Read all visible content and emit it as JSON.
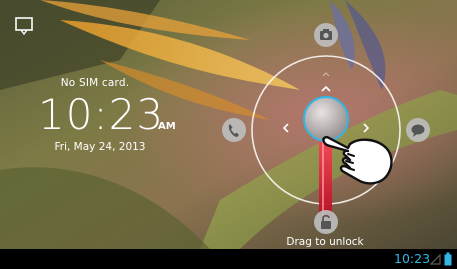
{
  "lockscreen": {
    "sim_status": "No SIM card.",
    "time": "10:23",
    "ampm": "AM",
    "date": "Fri, May 24, 2013",
    "unlock_hint": "Drag to unlock"
  },
  "status_bar": {
    "time": "10:23"
  },
  "unlock_targets": [
    "phone-icon",
    "camera-icon",
    "messaging-icon",
    "unlock-icon"
  ],
  "colors": {
    "accent": "#33b5e5",
    "drag_track": "#c4102a",
    "ring": "#ffffff"
  }
}
